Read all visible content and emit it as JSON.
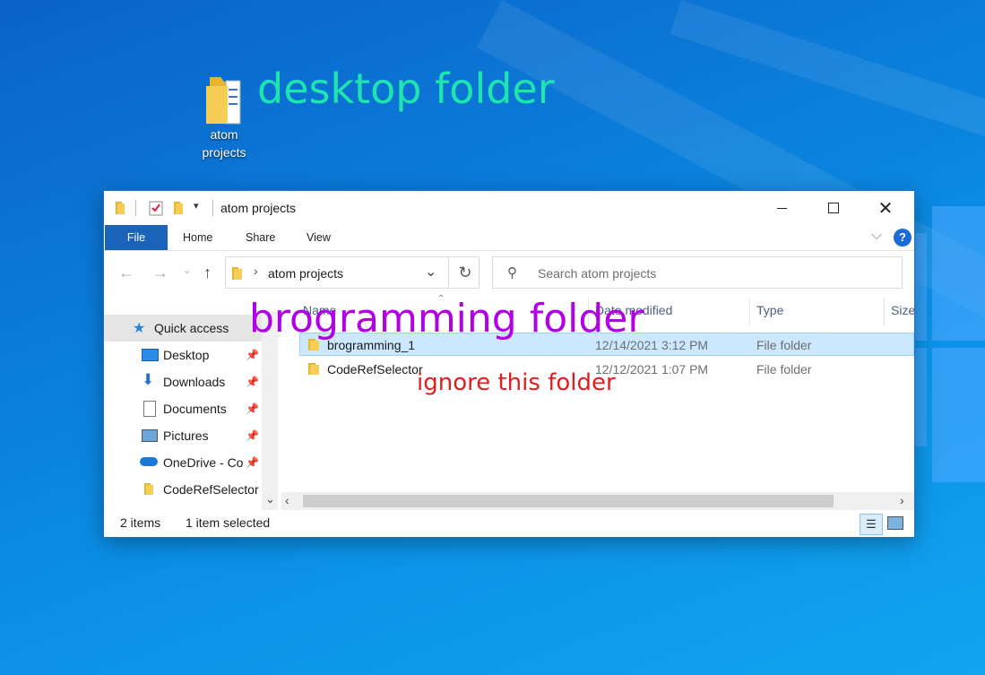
{
  "desktop": {
    "icon_label_line1": "atom",
    "icon_label_line2": "projects"
  },
  "annotations": {
    "desktop_note": "desktop folder",
    "desktop_note_color": "#1ee5b0",
    "folder_note": "brogramming folder",
    "folder_note_color": "#b100e8",
    "ignore_note": "ignore this folder",
    "ignore_note_color": "#e01e1e"
  },
  "window": {
    "title": "atom projects",
    "minimize_icon": "minimize-icon",
    "maximize_icon": "maximize-icon",
    "close_icon": "close-icon"
  },
  "ribbon": {
    "tabs": [
      "File",
      "Home",
      "Share",
      "View"
    ],
    "accent": "#1a63b8"
  },
  "address": {
    "path": "atom projects",
    "search_placeholder": "Search atom projects"
  },
  "nav": {
    "items": [
      {
        "label": "Quick access",
        "icon": "star-icon"
      },
      {
        "label": "Desktop",
        "icon": "desktop-icon",
        "pinned": true
      },
      {
        "label": "Downloads",
        "icon": "download-icon",
        "pinned": true
      },
      {
        "label": "Documents",
        "icon": "document-icon",
        "pinned": true
      },
      {
        "label": "Pictures",
        "icon": "pictures-icon",
        "pinned": true
      },
      {
        "label": "OneDrive - Co",
        "icon": "cloud-icon",
        "pinned": true
      },
      {
        "label": "CodeRefSelector",
        "icon": "folder-icon"
      }
    ]
  },
  "columns": {
    "name": "Name",
    "date": "Date modified",
    "type": "Type",
    "size": "Size"
  },
  "files": [
    {
      "name": "brogramming_1",
      "date": "12/14/2021 3:12 PM",
      "type": "File folder",
      "selected": true
    },
    {
      "name": "CodeRefSelector",
      "date": "12/12/2021 1:07 PM",
      "type": "File folder",
      "selected": false
    }
  ],
  "status": {
    "count": "2 items",
    "selection": "1 item selected"
  }
}
